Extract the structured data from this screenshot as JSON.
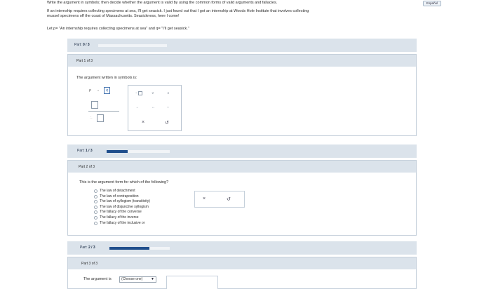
{
  "header": {
    "instructions": "Write the argument in symbols; then decide whether the argument is valid by using the common forms of valid arguments and fallacies.",
    "language_button": "Español",
    "scenario_line1": "If an internship requires collecting specimens at sea, I'll get seasick. I just found out that I got an internship at Woods Hole Institute that involves collecting",
    "scenario_line2": "mussel specimens off the coast of Massachusetts. Seasickness, here I come!",
    "definitions": "Let p= \"An internship requires collecting specimens at sea\" and q= \"I'll get seasick.\""
  },
  "part1": {
    "progress_label": "Part:",
    "progress_value": "0 / 3",
    "progress_fraction": 0.0,
    "header": "Part 1 of 3",
    "prompt": "The argument written in symbols is:",
    "premise_p": "p",
    "premise_arrow": "→",
    "premise_q": "q",
    "palette": {
      "not": "~",
      "or": "∨",
      "and": "∧",
      "arrow": "→",
      "bicond": "↔",
      "therefore": "∴",
      "clear": "×",
      "undo": "↺"
    },
    "therefore": "∴"
  },
  "part2": {
    "progress_label": "Part:",
    "progress_value": "1 / 3",
    "progress_fraction": 0.333,
    "header": "Part 2 of 3",
    "prompt": "This is the argument form for which of the following?",
    "options": [
      "The law of detachment",
      "The law of contraposition",
      "The law of syllogism (transitivity)",
      "The law of disjunctive syllogism",
      "The fallacy of the converse",
      "The fallacy of the inverse",
      "The fallacy of the inclusive or"
    ],
    "clear": "×",
    "undo": "↺"
  },
  "part3": {
    "progress_label": "Part:",
    "progress_value": "2 / 3",
    "progress_fraction": 0.667,
    "header": "Part 3 of 3",
    "prompt": "The argument is",
    "select_value": "(Choose one)",
    "select_arrow": "▼"
  }
}
